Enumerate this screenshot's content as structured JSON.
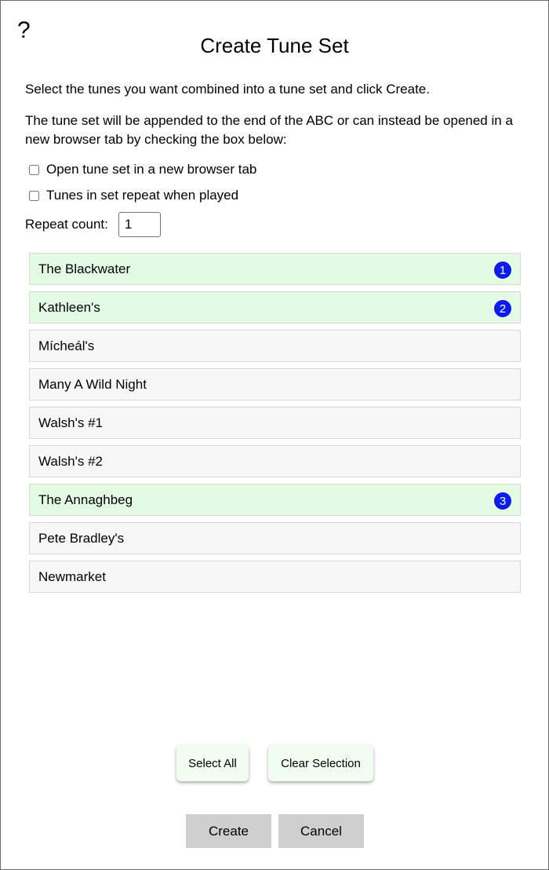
{
  "dialog": {
    "help_label": "?",
    "title": "Create Tune Set",
    "instructions": "Select the tunes you want combined into a tune set and click Create.",
    "description": "The tune set will be appended to the end of the ABC or can instead be opened in a new browser tab by checking the box below:"
  },
  "options": {
    "new_tab_label": "Open tune set in a new browser tab",
    "new_tab_checked": false,
    "repeat_label": "Tunes in set repeat when played",
    "repeat_checked": false,
    "repeat_count_label": "Repeat count:",
    "repeat_count_value": "1"
  },
  "tunes": [
    {
      "name": "The Blackwater",
      "selected": true,
      "order": "1"
    },
    {
      "name": "Kathleen's",
      "selected": true,
      "order": "2"
    },
    {
      "name": "Mícheál's",
      "selected": false,
      "order": ""
    },
    {
      "name": "Many A Wild Night",
      "selected": false,
      "order": ""
    },
    {
      "name": "Walsh's #1",
      "selected": false,
      "order": ""
    },
    {
      "name": "Walsh's #2",
      "selected": false,
      "order": ""
    },
    {
      "name": "The Annaghbeg",
      "selected": true,
      "order": "3"
    },
    {
      "name": "Pete Bradley's",
      "selected": false,
      "order": ""
    },
    {
      "name": "Newmarket",
      "selected": false,
      "order": ""
    }
  ],
  "buttons": {
    "select_all": "Select All",
    "clear_selection": "Clear Selection",
    "create": "Create",
    "cancel": "Cancel"
  },
  "colors": {
    "selected_row": "#e3fbe3",
    "unselected_row": "#f7f7f7",
    "badge": "#0a1cf2"
  }
}
